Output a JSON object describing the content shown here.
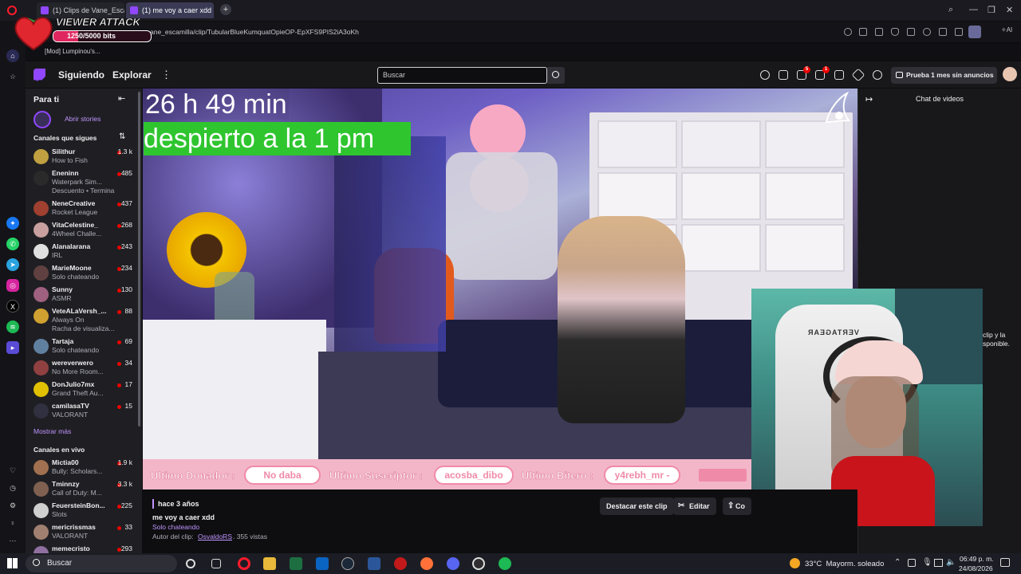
{
  "browser": {
    "tabs": [
      {
        "label": "(1) Clips de Vane_Escamilla"
      },
      {
        "label": "(1) me voy a caer xdd"
      }
    ],
    "address": "ane_escamilla/clip/TubularBlueKumquatOpieOP-EpXFS9PIS2iA3oKh",
    "bookmark": "[Mod] Lumpinou's...",
    "new_tab_symbol": "+"
  },
  "viewer_attack": {
    "title": "VIEWER ATTACK",
    "progress_text": "1250/5000 bits",
    "progress_fraction": 0.25
  },
  "twitch": {
    "nav": {
      "following": "Siguiendo",
      "browse": "Explorar",
      "more": "⋮"
    },
    "search_placeholder": "Buscar",
    "badges": {
      "inbox": "5",
      "whispers": "1"
    },
    "promo": "Prueba 1 mes sin anuncios"
  },
  "sidebar": {
    "for_you": "Para ti",
    "stories": "Abrir stories",
    "followed_header": "Canales que sigues",
    "followed": [
      {
        "name": "Silithur",
        "game": "How to Fish",
        "viewers": "1.3 k",
        "color": "#c0a040"
      },
      {
        "name": "Eneninn",
        "game": "Waterpark Sim...",
        "viewers": "485",
        "color": "#2a2a2a",
        "extra": "Descuento • Termina"
      },
      {
        "name": "NeneCreative",
        "game": "Rocket League",
        "viewers": "437",
        "color": "#a04030"
      },
      {
        "name": "VitaCelestine_",
        "game": "4Wheel Challe...",
        "viewers": "268",
        "color": "#c8a0a0"
      },
      {
        "name": "Alanalarana",
        "game": "IRL",
        "viewers": "243",
        "color": "#e0e0e0"
      },
      {
        "name": "MarieMoone",
        "game": "Solo chateando",
        "viewers": "234",
        "color": "#604040"
      },
      {
        "name": "Sunny",
        "game": "ASMR",
        "viewers": "130",
        "color": "#a06080"
      },
      {
        "name": "VeteALaVersh_...",
        "game": "Always On",
        "viewers": "88",
        "color": "#d0a030",
        "extra": "Racha de visualiza..."
      },
      {
        "name": "Tartaja",
        "game": "Solo chateando",
        "viewers": "69",
        "color": "#6080a0"
      },
      {
        "name": "wereverwero",
        "game": "No More Room...",
        "viewers": "34",
        "color": "#904040"
      },
      {
        "name": "DonJulio7mx",
        "game": "Grand Theft Au...",
        "viewers": "17",
        "color": "#e0c000"
      },
      {
        "name": "camilasaTV",
        "game": "VALORANT",
        "viewers": "15",
        "color": "#303040"
      }
    ],
    "show_more": "Mostrar más",
    "live_header": "Canales en vivo",
    "live": [
      {
        "name": "Mictia00",
        "game": "Bully: Scholars...",
        "viewers": "1.9 k",
        "color": "#a07050"
      },
      {
        "name": "Tminnzy",
        "game": "Call of Duty: M...",
        "viewers": "3.3 k",
        "color": "#806050"
      },
      {
        "name": "FeuersteinBon...",
        "game": "Slots",
        "viewers": "225",
        "color": "#d0d0d0"
      },
      {
        "name": "mericrissmas",
        "game": "VALORANT",
        "viewers": "33",
        "color": "#a08070"
      },
      {
        "name": "memecristo",
        "game": "",
        "viewers": "293",
        "color": "#9070a0"
      }
    ]
  },
  "video": {
    "caption_time": "26 h 49 min",
    "caption_wake": "despierto a la 1 pm",
    "overlay": {
      "donor_label": "Ultimo Donador :",
      "donor_value": "No daba",
      "sub_label": "Ultimo Suscriptor :",
      "sub_value": "acosba_dibo",
      "bits_label": "Ultimo Bitero :",
      "bits_value": "y4rebh_mr -"
    },
    "chair_brand": "VERTAGEAR"
  },
  "chat": {
    "title": "Chat de videos",
    "partial_text_1": "clip y la",
    "partial_text_2": "sponible."
  },
  "clip": {
    "age": "hace 3 años",
    "title": "me voy a caer xdd",
    "category": "Solo chateando",
    "author_label": "Autor del clip:",
    "author": "OsvaldoRS",
    "views": ". 355 vistas",
    "feature_button": "Destacar este clip",
    "edit_button": "Editar",
    "share_button": "Co"
  },
  "taskbar": {
    "search": "Buscar",
    "weather": "33°C  Mayorm. soleado",
    "time": "06:49 p. m.",
    "date": "24/08/2026"
  },
  "colors": {
    "twitch_purple": "#9147ff",
    "live_red": "#eb0400",
    "overlay_pink": "#f3b6c9"
  }
}
